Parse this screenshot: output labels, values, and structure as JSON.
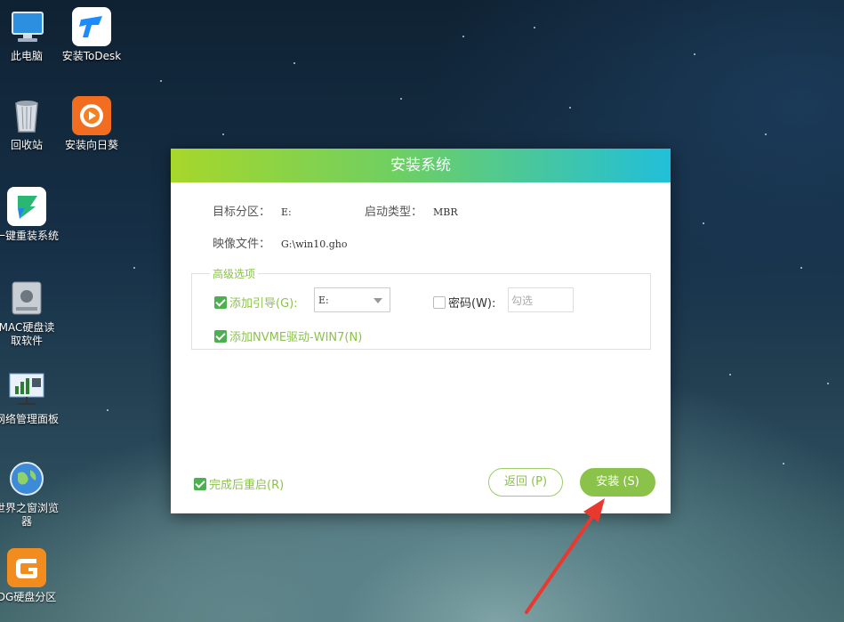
{
  "desktop": {
    "icons": [
      {
        "label": "此电脑",
        "icon": "computer-icon"
      },
      {
        "label": "安装ToDesk",
        "icon": "todesk-icon"
      },
      {
        "label": "回收站",
        "icon": "recycle-bin-icon"
      },
      {
        "label": "安装向日葵",
        "icon": "sunflower-icon"
      },
      {
        "label": "一键重装系统",
        "icon": "reinstall-icon"
      },
      {
        "label": "MAC硬盘读\n取软件",
        "icon": "mac-disk-icon"
      },
      {
        "label": "网络管理面板",
        "icon": "network-panel-icon"
      },
      {
        "label": "世界之窗浏览\n器",
        "icon": "browser-globe-icon"
      },
      {
        "label": "DG硬盘分区",
        "icon": "diskgenius-icon"
      }
    ]
  },
  "dialog": {
    "title": "安装系统",
    "target_partition_label": "目标分区：",
    "target_partition_value": "E:",
    "boot_type_label": "启动类型：",
    "boot_type_value": "MBR",
    "image_file_label": "映像文件：",
    "image_file_value": "G:\\win10.gho",
    "advanced_title": "高级选项",
    "add_boot_label": "添加引导(G):",
    "add_boot_checked": true,
    "add_boot_drive": "E:",
    "password_label": "密码(W):",
    "password_checked": false,
    "password_placeholder": "勾选",
    "add_nvme_label": "添加NVME驱动-WIN7(N)",
    "add_nvme_checked": true,
    "restart_label": "完成后重启(R)",
    "restart_checked": true,
    "back_button": "返回 (P)",
    "install_button": "安装 (S)"
  },
  "colors": {
    "accent_green": "#8bc34a",
    "title_gradient_start": "#a7d72a",
    "title_gradient_end": "#21bfd9",
    "arrow_red": "#e8392f"
  }
}
